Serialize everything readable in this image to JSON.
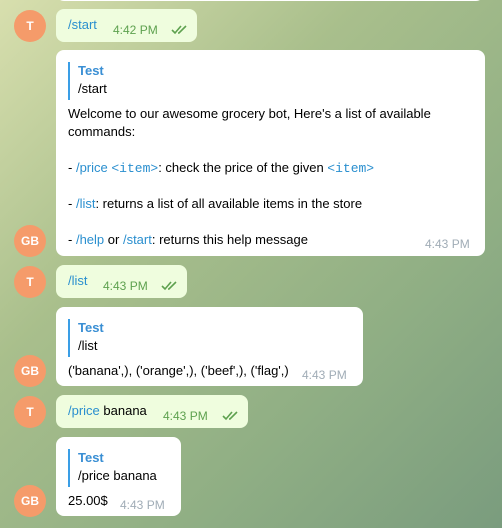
{
  "chat": {
    "user_avatar": "T",
    "bot_avatar": "GB",
    "messages": [
      {
        "cmd": "/start",
        "time": "4:42 PM"
      },
      {
        "quote_name": "Test",
        "quote_text": "/start",
        "welcome_1": "Welcome to our awesome grocery bot, Here's a list of available",
        "welcome_2": "commands:",
        "price_dash": "- ",
        "price_cmd": "/price",
        "price_space": " ",
        "price_arg": "<item>",
        "price_desc": ": check the price of the given ",
        "price_arg2": "<item>",
        "list_dash": "- ",
        "list_cmd": "/list",
        "list_desc": ": returns a list of all available items in the store",
        "help_dash": "- ",
        "help_cmd": "/help",
        "help_or": " or ",
        "help_cmd2": "/start",
        "help_desc": ": returns this help message",
        "time": "4:43 PM"
      },
      {
        "cmd": "/list",
        "time": "4:43 PM"
      },
      {
        "quote_name": "Test",
        "quote_text": "/list",
        "text": "('banana',), ('orange',), ('beef',), ('flag',)",
        "time": "4:43 PM"
      },
      {
        "cmd": "/price",
        "arg": " banana",
        "time": "4:43 PM"
      },
      {
        "quote_name": "Test",
        "quote_text": "/price banana",
        "text": "25.00$",
        "time": "4:43 PM"
      }
    ]
  },
  "colors": {
    "accent": "#2a8fcf",
    "outgoing_bubble": "#effdde",
    "incoming_bubble": "#ffffff",
    "avatar": "#f59b6a",
    "read_ticks": "#5ea14f"
  },
  "icons": {
    "read": "double-check-icon"
  }
}
